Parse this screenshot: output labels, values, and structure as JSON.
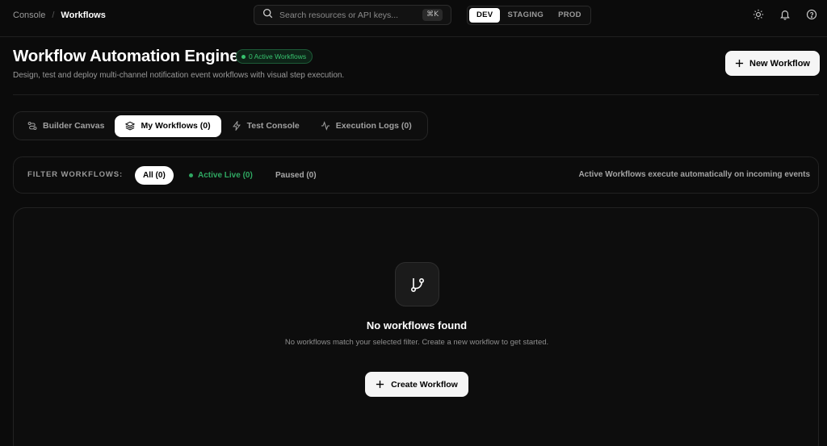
{
  "breadcrumb": {
    "root": "Console",
    "separator": "/",
    "current": "Workflows"
  },
  "search": {
    "placeholder": "Search resources or API keys...",
    "shortcut": "⌘K"
  },
  "environments": {
    "items": [
      "DEV",
      "STAGING",
      "PROD"
    ],
    "active": "DEV"
  },
  "top_icons": [
    "sun-icon",
    "bell-icon",
    "help-circle-icon"
  ],
  "header": {
    "title": "Workflow Automation Engine",
    "badge": "0 Active Workflows",
    "subtitle": "Design, test and deploy multi-channel notification event workflows with visual step execution.",
    "new_button": "New Workflow"
  },
  "tabs": [
    {
      "label": "Builder Canvas",
      "icon": "route-icon"
    },
    {
      "label": "My Workflows (0)",
      "icon": "layers-icon",
      "active": true
    },
    {
      "label": "Test Console",
      "icon": "zap-icon"
    },
    {
      "label": "Execution Logs (0)",
      "icon": "activity-icon"
    }
  ],
  "filters": {
    "label": "FILTER WORKFLOWS:",
    "all": "All (0)",
    "active": "Active Live (0)",
    "paused": "Paused (0)",
    "hint": "Active Workflows execute automatically on incoming events"
  },
  "empty_state": {
    "icon": "git-branch-icon",
    "title": "No workflows found",
    "description": "No workflows match your selected filter. Create a new workflow to get started.",
    "button": "Create Workflow"
  },
  "colors": {
    "background": "#0b0b0b",
    "accent_green": "#37c26e",
    "primary_button": "#f5f5f5"
  }
}
